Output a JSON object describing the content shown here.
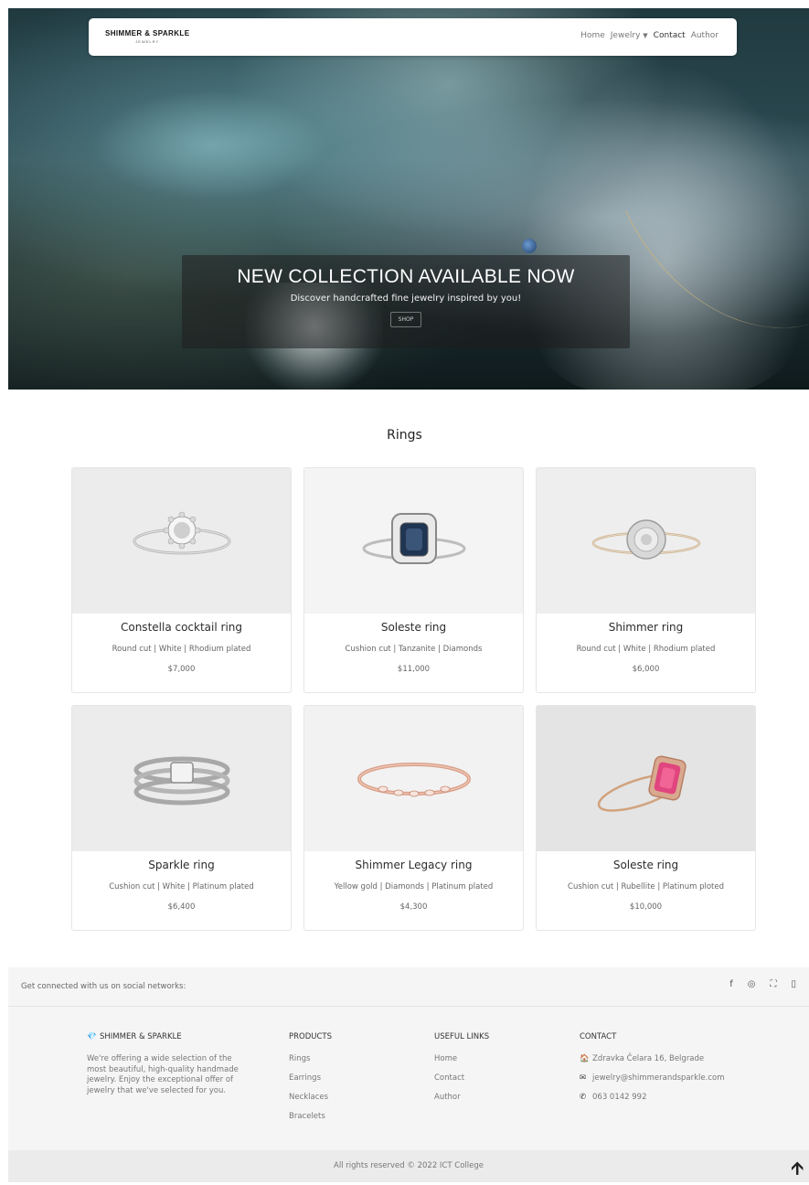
{
  "nav": {
    "brand_name": "SHIMMER & SPARKLE",
    "brand_sub": "JEWELRY",
    "links": [
      "Home",
      "Jewelry",
      "Contact",
      "Author"
    ]
  },
  "hero": {
    "title": "NEW COLLECTION AVAILABLE NOW",
    "subtitle": "Discover handcrafted fine jewelry inspired by you!",
    "button": "SHOP"
  },
  "rings": {
    "title": "Rings",
    "items": [
      {
        "name": "Constella cocktail ring",
        "desc": "Round cut | White | Rhodium plated",
        "price": "$7,000"
      },
      {
        "name": "Soleste ring",
        "desc": "Cushion cut | Tanzanite | Diamonds",
        "price": "$11,000"
      },
      {
        "name": "Shimmer ring",
        "desc": "Round cut | White | Rhodium plated",
        "price": "$6,000"
      },
      {
        "name": "Sparkle ring",
        "desc": "Cushion cut | White | Platinum plated",
        "price": "$6,400"
      },
      {
        "name": "Shimmer Legacy ring",
        "desc": "Yellow gold | Diamonds | Platinum plated",
        "price": "$4,300"
      },
      {
        "name": "Soleste ring",
        "desc": "Cushion cut | Rubellite | Platinum ploted",
        "price": "$10,000"
      }
    ]
  },
  "footer": {
    "social_text": "Get connected with us on social networks:",
    "social_icons": [
      "f",
      "◎",
      "⛶",
      "▯"
    ],
    "about": {
      "title": "SHIMMER & SPARKLE",
      "text": "We're offering a wide selection of the most beautiful, high-quality handmade jewelry. Enjoy the exceptional offer of jewelry that we've selected for you."
    },
    "products": {
      "title": "PRODUCTS",
      "items": [
        "Rings",
        "Earrings",
        "Necklaces",
        "Bracelets"
      ]
    },
    "useful": {
      "title": "USEFUL LINKS",
      "items": [
        "Home",
        "Contact",
        "Author"
      ]
    },
    "contact": {
      "title": "CONTACT",
      "address": "Zdravka Čelara 16, Belgrade",
      "email": "jewelry@shimmerandsparkle.com",
      "phone": "063 0142 992"
    },
    "copyright": "All rights reserved © 2022 ICT College",
    "back_to_top": "🡩"
  }
}
